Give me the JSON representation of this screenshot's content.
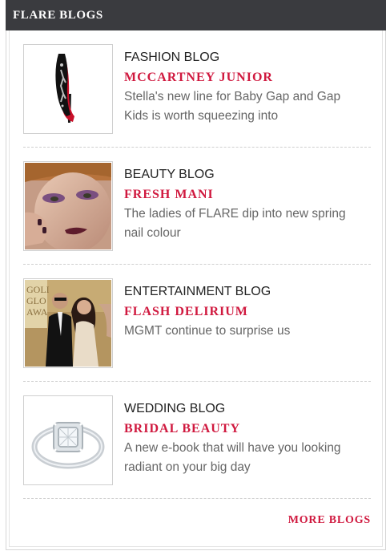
{
  "widget": {
    "title": "FLARE BLOGS",
    "more_label": "MORE BLOGS",
    "colors": {
      "header_bg": "#3a3b3f",
      "accent": "#d0193f",
      "category_text": "#222222",
      "desc_text": "#666666"
    }
  },
  "entries": [
    {
      "category": "FASHION BLOG",
      "title": "MCCARTNEY JUNIOR",
      "desc": "Stella's new line for Baby Gap and Gap Kids is worth squeezing into",
      "image": "high-heel-shoe-photo"
    },
    {
      "category": "BEAUTY BLOG",
      "title": "FRESH MANI",
      "desc": "The ladies of FLARE dip into new spring nail colour",
      "image": "beauty-model-photo"
    },
    {
      "category": "ENTERTAINMENT BLOG",
      "title": "FLASH DELIRIUM",
      "desc": "MGMT continue to surprise us",
      "image": "celebrity-couple-photo"
    },
    {
      "category": "WEDDING BLOG",
      "title": "BRIDAL BEAUTY",
      "desc": "A new e-book that will have you looking radiant on your big day",
      "image": "diamond-ring-photo"
    }
  ]
}
